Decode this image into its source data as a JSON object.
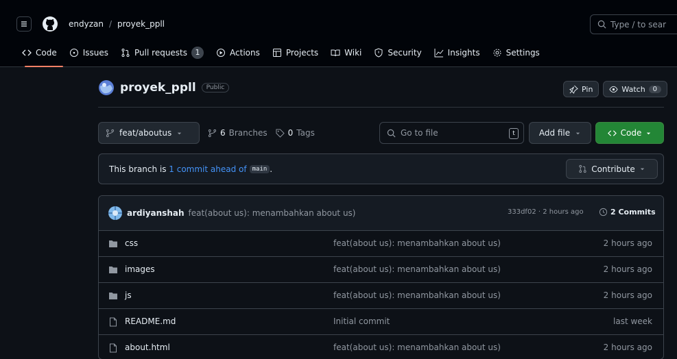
{
  "header": {
    "owner": "endyzan",
    "separator": "/",
    "repo": "proyek_ppll",
    "search_placeholder": "Type / to sear",
    "search_key": "/"
  },
  "tabs": [
    {
      "label": "Code",
      "icon": "code-icon",
      "active": true
    },
    {
      "label": "Issues",
      "icon": "issue-icon"
    },
    {
      "label": "Pull requests",
      "icon": "pull-request-icon",
      "count": "1"
    },
    {
      "label": "Actions",
      "icon": "play-icon"
    },
    {
      "label": "Projects",
      "icon": "table-icon"
    },
    {
      "label": "Wiki",
      "icon": "book-icon"
    },
    {
      "label": "Security",
      "icon": "shield-icon"
    },
    {
      "label": "Insights",
      "icon": "graph-icon"
    },
    {
      "label": "Settings",
      "icon": "gear-icon"
    }
  ],
  "repo": {
    "name": "proyek_ppll",
    "visibility": "Public",
    "pin_label": "Pin",
    "watch_label": "Watch",
    "watch_count": "0"
  },
  "controls": {
    "branch": "feat/aboutus",
    "branches_count": "6",
    "branches_label": "Branches",
    "tags_count": "0",
    "tags_label": "Tags",
    "go_to_file": "Go to file",
    "go_to_file_key": "t",
    "add_file": "Add file",
    "code": "Code"
  },
  "branch_info": {
    "prefix": "This branch is",
    "ahead_link": "1 commit ahead of",
    "base": "main",
    "suffix": ".",
    "contribute": "Contribute"
  },
  "latest_commit": {
    "author": "ardiyanshah",
    "message": "feat(about us): menambahkan about us)",
    "hash_time": "333df02 · 2 hours ago",
    "commits": "2 Commits"
  },
  "files": [
    {
      "type": "folder",
      "name": "css",
      "message": "feat(about us): menambahkan about us)",
      "time": "2 hours ago"
    },
    {
      "type": "folder",
      "name": "images",
      "message": "feat(about us): menambahkan about us)",
      "time": "2 hours ago"
    },
    {
      "type": "folder",
      "name": "js",
      "message": "feat(about us): menambahkan about us)",
      "time": "2 hours ago"
    },
    {
      "type": "file",
      "name": "README.md",
      "message": "Initial commit",
      "time": "last week"
    },
    {
      "type": "file",
      "name": "about.html",
      "message": "feat(about us): menambahkan about us)",
      "time": "2 hours ago"
    }
  ],
  "colors": {
    "background": "#0d1117",
    "header": "#010409",
    "accent_tab": "#f78166",
    "link": "#4493f8",
    "primary_button": "#238636"
  }
}
